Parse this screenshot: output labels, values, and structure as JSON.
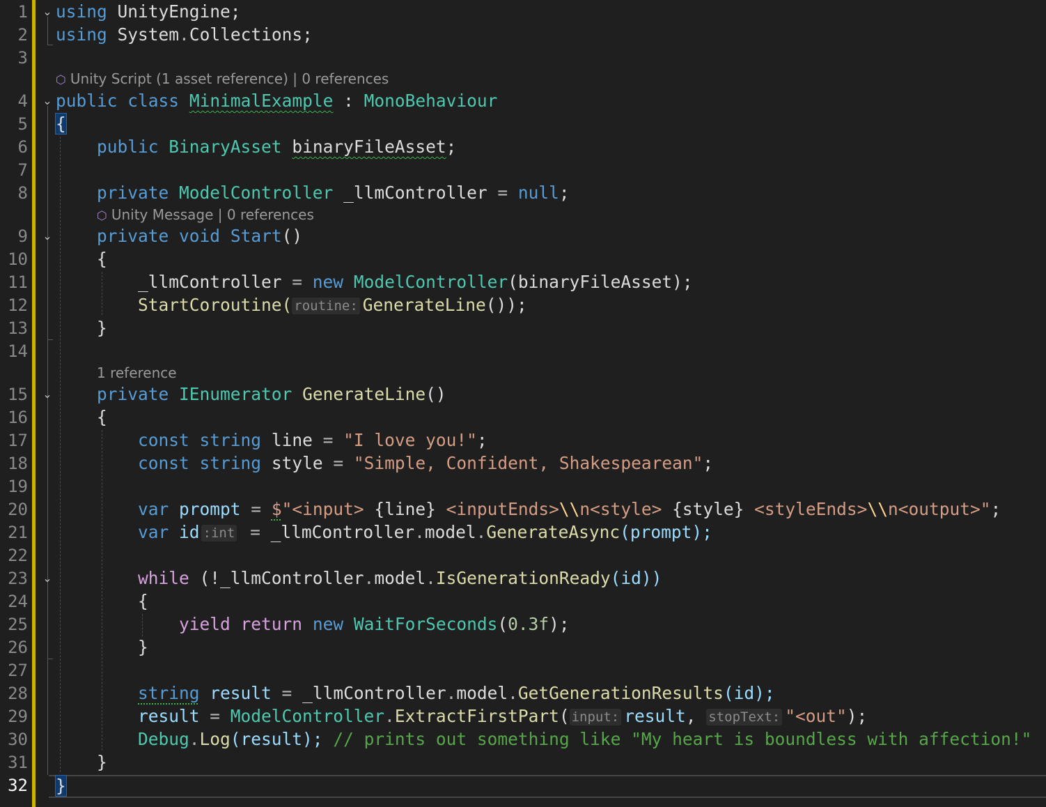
{
  "editor": {
    "line_numbers": [
      "1",
      "2",
      "3",
      "4",
      "5",
      "6",
      "7",
      "8",
      "9",
      "10",
      "11",
      "12",
      "13",
      "14",
      "15",
      "16",
      "17",
      "18",
      "19",
      "20",
      "21",
      "22",
      "23",
      "24",
      "25",
      "26",
      "27",
      "28",
      "29",
      "30",
      "31",
      "32"
    ],
    "current_line": "32",
    "lens": {
      "class_info": "Unity Script (1 asset reference) | 0 references",
      "start_info": "Unity Message | 0 references",
      "generate_info": "1 reference"
    },
    "code": {
      "l1": {
        "kw": "using",
        "ns": "UnityEngine;"
      },
      "l2": {
        "kw": "using",
        "ns": "System",
        "dot": ".",
        "ns2": "Collections;"
      },
      "l4": {
        "kw1": "public",
        "kw2": "class",
        "name": "MinimalExample",
        "colon": " : ",
        "base": "MonoBehaviour"
      },
      "l5": {
        "brace": "{"
      },
      "l6": {
        "kw": "public",
        "type": "BinaryAsset",
        "field": "binaryFileAsset",
        "semi": ";"
      },
      "l8": {
        "kw": "private",
        "type": "ModelController",
        "field": "_llmController",
        "eq": " = ",
        "val": "null",
        "semi": ";"
      },
      "l9": {
        "kw1": "private",
        "kw2": "void",
        "fn": "Start",
        "paren": "()"
      },
      "l10": {
        "brace": "{"
      },
      "l11": {
        "field": "_llmController",
        "eq": " = ",
        "kw": "new",
        "type": "ModelController",
        "args": "(binaryFileAsset);"
      },
      "l12": {
        "fn": "StartCoroutine(",
        "hint": "routine:",
        "fn2": "GenerateLine",
        "rest": "());"
      },
      "l13": {
        "brace": "}"
      },
      "l15": {
        "kw": "private",
        "type": "IEnumerator",
        "fn": "GenerateLine",
        "paren": "()"
      },
      "l16": {
        "brace": "{"
      },
      "l17": {
        "kw1": "const",
        "kw2": "string",
        "var": "line",
        "eq": " = ",
        "str": "\"I love you!\"",
        "semi": ";"
      },
      "l18": {
        "kw1": "const",
        "kw2": "string",
        "var": "style",
        "eq": " = ",
        "str": "\"Simple, Confident, Shakespearean\"",
        "semi": ";"
      },
      "l20": {
        "kw": "var",
        "var": "prompt",
        "eq": " = ",
        "dollar": "$",
        "s1": "\"<input> ",
        "i1": "{line}",
        "s2": " <inputEnds>",
        "e1": "\\\\",
        "s3": "n<style> ",
        "i2": "{style}",
        "s4": " <styleEnds>",
        "e2": "\\\\",
        "s5": "n<output>\"",
        "semi": ";"
      },
      "l21": {
        "kw": "var",
        "var": "id",
        "hint": ":int",
        "eq": " = ",
        "obj": "_llmController",
        "dot1": ".",
        "prop": "model",
        "dot2": ".",
        "fn": "GenerateAsync",
        "args": "(prompt);"
      },
      "l23": {
        "kw": "while",
        "open": " (!",
        "obj": "_llmController",
        "dot1": ".",
        "prop": "model",
        "dot2": ".",
        "fn": "IsGenerationReady",
        "args": "(id))"
      },
      "l24": {
        "brace": "{"
      },
      "l25": {
        "kw1": "yield",
        "kw2": "return",
        "kw3": "new",
        "type": "WaitForSeconds",
        "num": "0.3f",
        "open": "(",
        "close": ");"
      },
      "l26": {
        "brace": "}"
      },
      "l28": {
        "kw": "string",
        "var": "result",
        "eq": " = ",
        "obj": "_llmController",
        "dot1": ".",
        "prop": "model",
        "dot2": ".",
        "fn": "GetGenerationResults",
        "args": "(id);"
      },
      "l29": {
        "var": "result",
        "eq": " = ",
        "type": "ModelController",
        "dot": ".",
        "fn": "ExtractFirstPart",
        "open": "(",
        "hint1": "input:",
        "arg1": "result",
        "comma": ", ",
        "hint2": "stopText:",
        "str": "\"<out\"",
        "close": ");"
      },
      "l30": {
        "type": "Debug",
        "dot": ".",
        "fn": "Log",
        "args": "(result);",
        "comment": "// prints out something like \"My heart is boundless with affection!\""
      },
      "l31": {
        "brace": "}"
      },
      "l32": {
        "brace": "}"
      }
    }
  }
}
